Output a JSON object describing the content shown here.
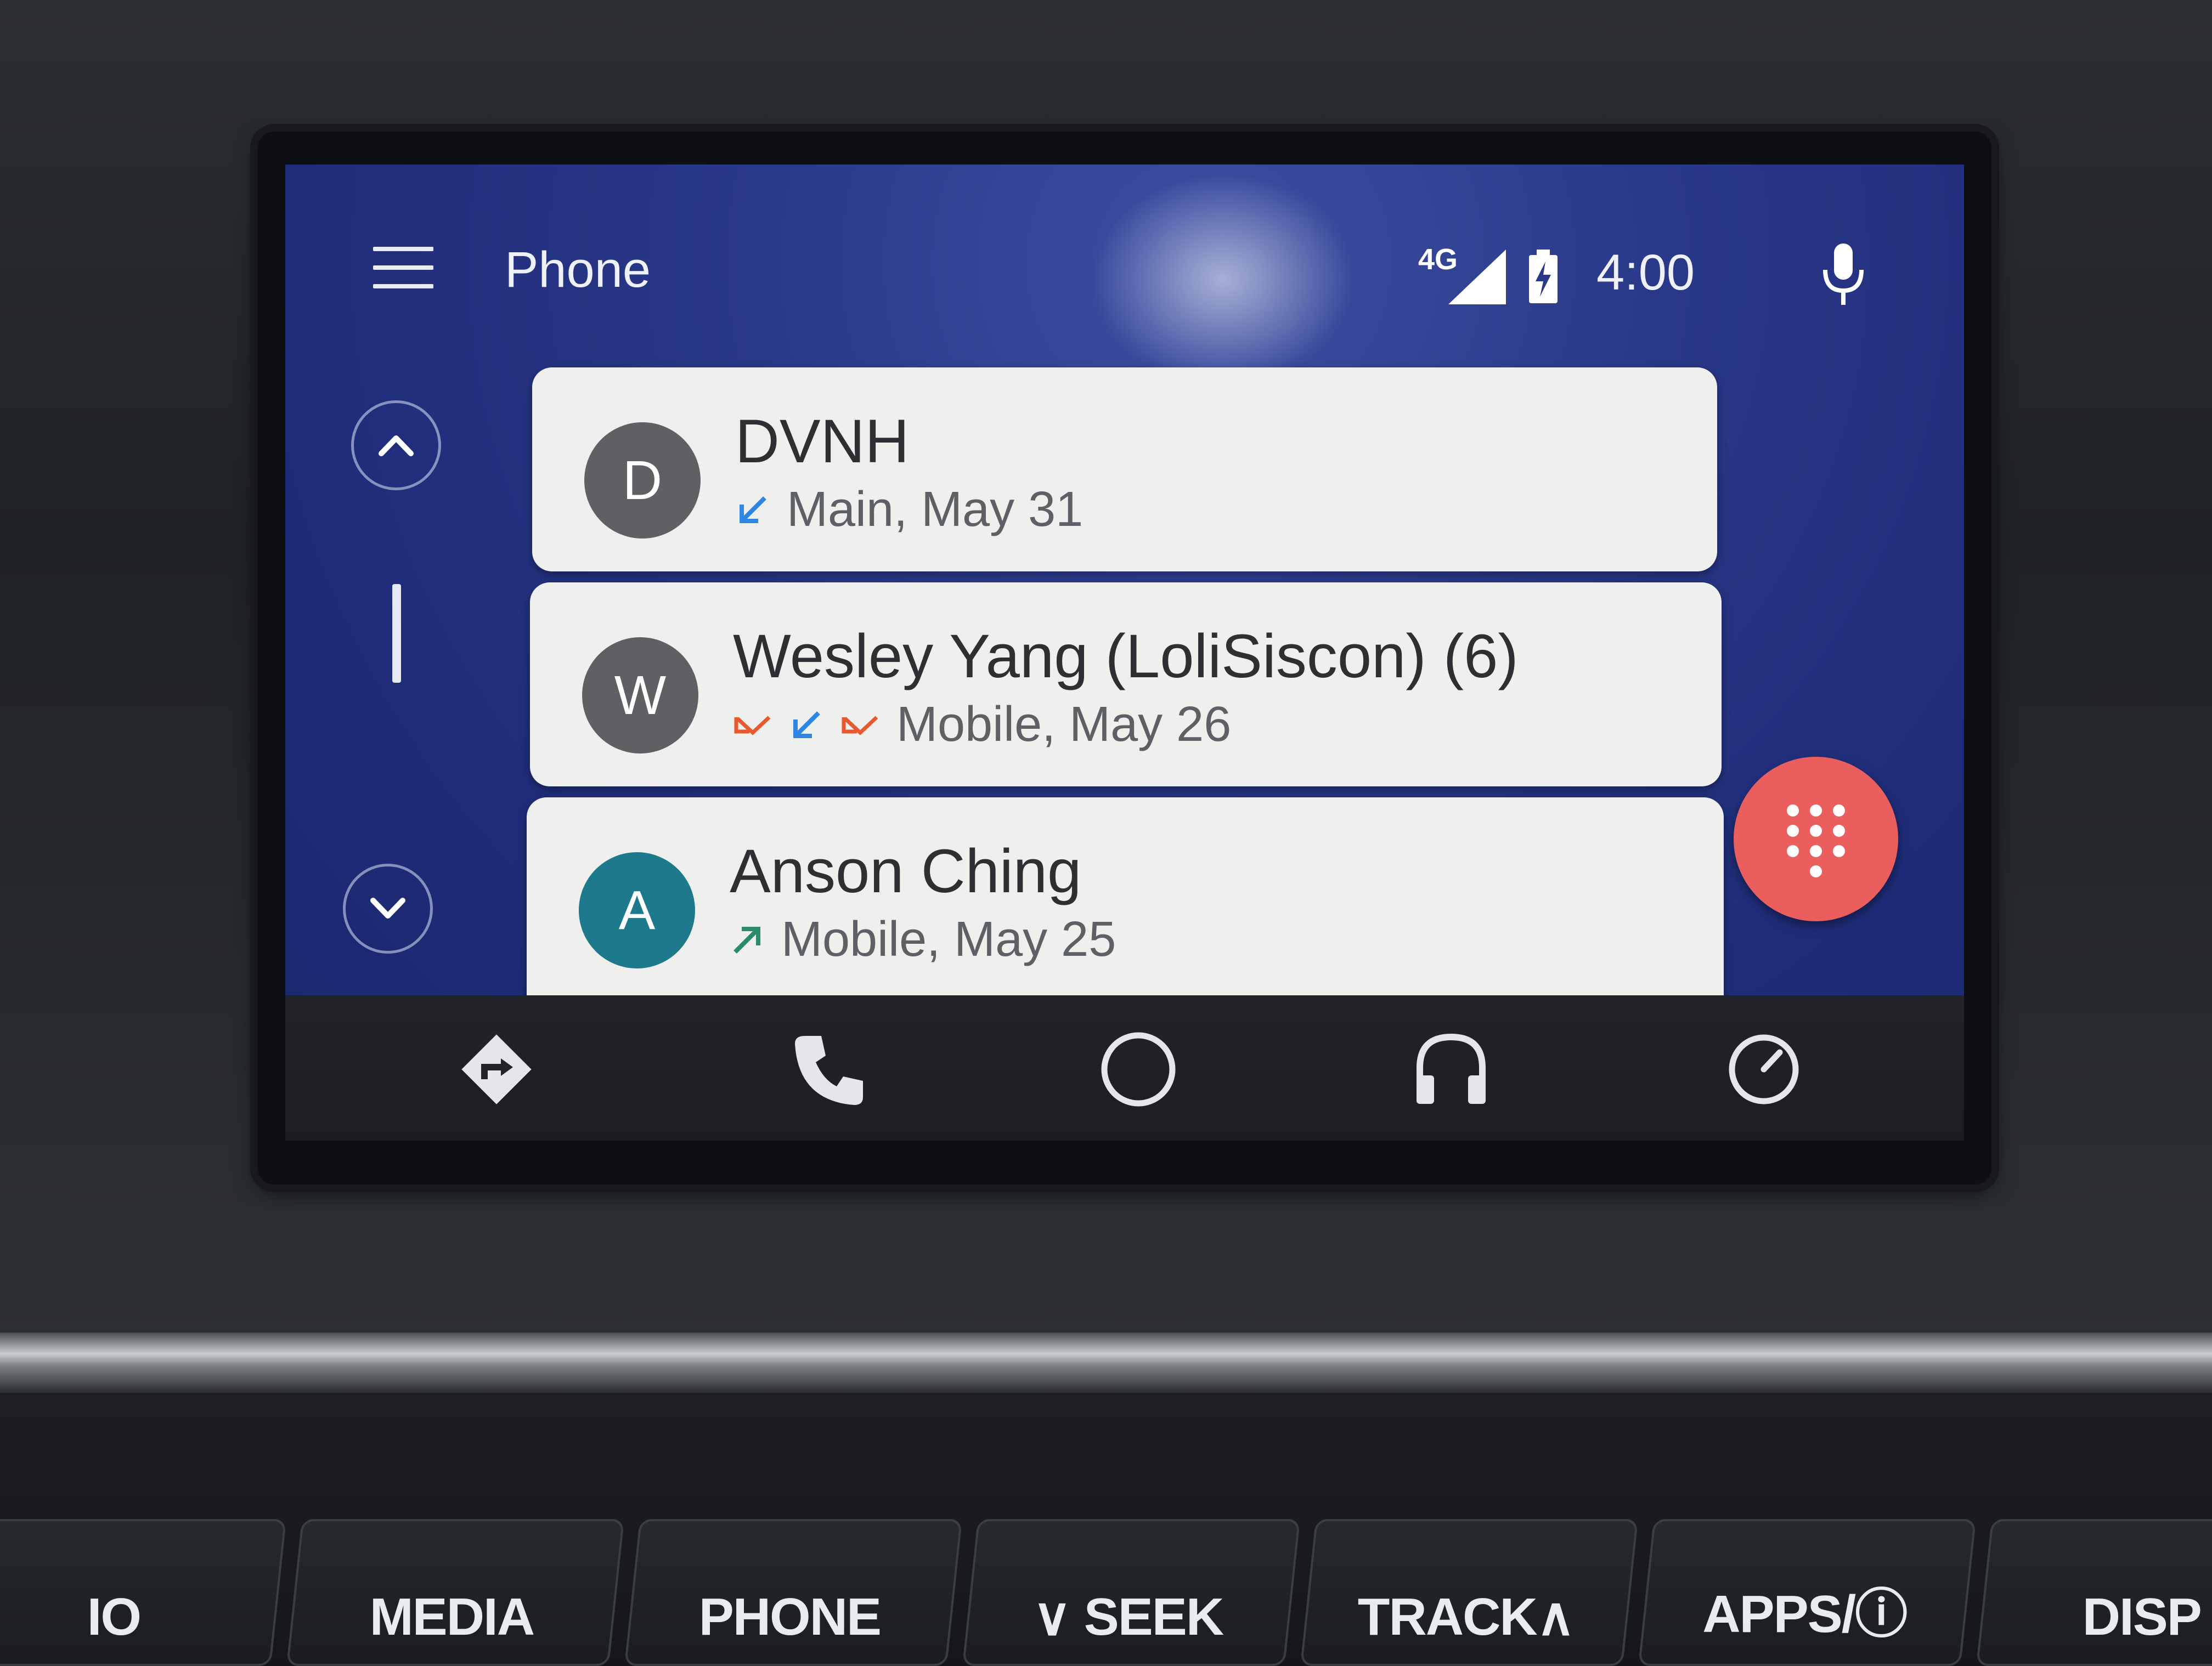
{
  "app": {
    "title": "Phone",
    "status": {
      "network": "4G",
      "battery_state": "charging",
      "time": "4:00"
    }
  },
  "call_log": [
    {
      "initial": "D",
      "name": "DVNH",
      "avatar_color": "#5f6064",
      "call_types": [
        "incoming"
      ],
      "detail": "Main, May 31"
    },
    {
      "initial": "W",
      "name": "Wesley Yang (LoliSiscon) (6)",
      "avatar_color": "#5f6064",
      "call_types": [
        "missed",
        "incoming",
        "missed"
      ],
      "detail": "Mobile, May 26"
    },
    {
      "initial": "A",
      "name": "Anson Ching",
      "avatar_color": "#1c7a8c",
      "call_types": [
        "outgoing"
      ],
      "detail": "Mobile, May 25"
    }
  ],
  "colors": {
    "incoming": "#2f86e3",
    "outgoing": "#2e8a6e",
    "missed": "#e8592f",
    "fab": "#ea5e5e"
  },
  "nav": [
    "navigation-icon",
    "phone-icon",
    "home-icon",
    "headphones-icon",
    "exit-icon"
  ],
  "hardware_buttons": [
    "IO",
    "MEDIA",
    "PHONE",
    "∨ SEEK",
    "TRACK∧",
    "APPS/ⓘ",
    "DISP"
  ]
}
